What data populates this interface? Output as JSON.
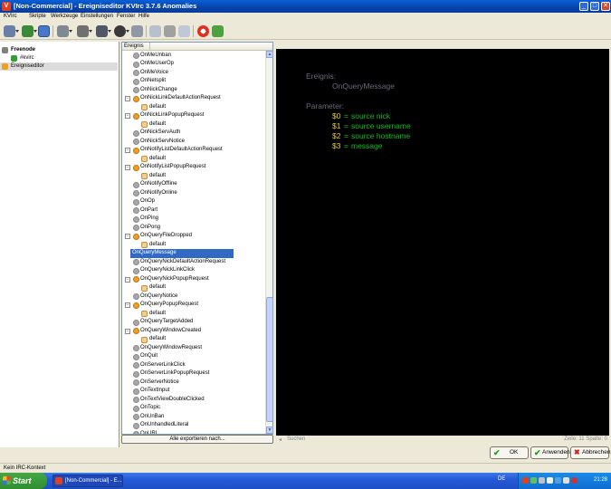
{
  "window": {
    "title": "[Non-Commercial] - Ereigniseditor KVIrc 3.7.6 Anomalies",
    "app_icon_glyph": "V",
    "controls": {
      "minimize": "_",
      "maximize": "□",
      "close": "✕"
    }
  },
  "menu": [
    "KVIrc",
    "Skripte",
    "Werkzeuge",
    "Einstellungen",
    "Fenster",
    "Hilfe"
  ],
  "sidebar": {
    "items": [
      {
        "label": "Freenode",
        "bold": true,
        "icon": "network-icon"
      },
      {
        "label": "#kvirc",
        "icon": "channel-icon"
      },
      {
        "label": "Ereigniseditor",
        "icon": "event-editor-icon",
        "selected": true
      }
    ]
  },
  "event_list": {
    "column_header": "Ereignis",
    "export_button": "Alle exportieren nach...",
    "items": [
      {
        "label": "OnMeUnban",
        "type": "event"
      },
      {
        "label": "OnMeUserOp",
        "type": "event"
      },
      {
        "label": "OnMeVoice",
        "type": "event"
      },
      {
        "label": "OnNetsplit",
        "type": "event"
      },
      {
        "label": "OnNickChange",
        "type": "event"
      },
      {
        "label": "OnNickLinkDefaultActionRequest",
        "type": "group"
      },
      {
        "label": "default",
        "type": "handler"
      },
      {
        "label": "OnNickLinkPopupRequest",
        "type": "group"
      },
      {
        "label": "default",
        "type": "handler"
      },
      {
        "label": "OnNickServAuth",
        "type": "event"
      },
      {
        "label": "OnNickServNotice",
        "type": "event"
      },
      {
        "label": "OnNotifyListDefaultActionRequest",
        "type": "group"
      },
      {
        "label": "default",
        "type": "handler"
      },
      {
        "label": "OnNotifyListPopupRequest",
        "type": "group"
      },
      {
        "label": "default",
        "type": "handler"
      },
      {
        "label": "OnNotifyOffline",
        "type": "event"
      },
      {
        "label": "OnNotifyOnline",
        "type": "event"
      },
      {
        "label": "OnOp",
        "type": "event"
      },
      {
        "label": "OnPart",
        "type": "event"
      },
      {
        "label": "OnPing",
        "type": "event"
      },
      {
        "label": "OnPong",
        "type": "event"
      },
      {
        "label": "OnQueryFileDropped",
        "type": "group"
      },
      {
        "label": "default",
        "type": "handler"
      },
      {
        "label": "OnQueryMessage",
        "type": "event",
        "selected": true
      },
      {
        "label": "OnQueryNickDefaultActionRequest",
        "type": "event"
      },
      {
        "label": "OnQueryNickLinkClick",
        "type": "event"
      },
      {
        "label": "OnQueryNickPopupRequest",
        "type": "group"
      },
      {
        "label": "default",
        "type": "handler"
      },
      {
        "label": "OnQueryNotice",
        "type": "event"
      },
      {
        "label": "OnQueryPopupRequest",
        "type": "group"
      },
      {
        "label": "default",
        "type": "handler"
      },
      {
        "label": "OnQueryTargetAdded",
        "type": "event"
      },
      {
        "label": "OnQueryWindowCreated",
        "type": "group"
      },
      {
        "label": "default",
        "type": "handler"
      },
      {
        "label": "OnQueryWindowRequest",
        "type": "event"
      },
      {
        "label": "OnQuit",
        "type": "event"
      },
      {
        "label": "OnServerLinkClick",
        "type": "event"
      },
      {
        "label": "OnServerLinkPopupRequest",
        "type": "event"
      },
      {
        "label": "OnServerNotice",
        "type": "event"
      },
      {
        "label": "OnTextInput",
        "type": "event"
      },
      {
        "label": "OnTextViewDoubleClicked",
        "type": "event"
      },
      {
        "label": "OnTopic",
        "type": "event"
      },
      {
        "label": "OnUnBan",
        "type": "event"
      },
      {
        "label": "OnUnhandledLiteral",
        "type": "event"
      },
      {
        "label": "OnURL",
        "type": "event"
      }
    ]
  },
  "editor": {
    "event_heading": "Ereignis:",
    "event_name": "OnQueryMessage",
    "params_heading": "Parameter:",
    "params": [
      {
        "var": "$0",
        "desc": "source nick"
      },
      {
        "var": "$1",
        "desc": "source username"
      },
      {
        "var": "$2",
        "desc": "source hostname"
      },
      {
        "var": "$3",
        "desc": "message"
      }
    ],
    "search_label": "Suchen",
    "position": "Zeile: 11 Spalte: 0"
  },
  "buttons": {
    "ok": "OK",
    "apply": "Anwenden",
    "cancel": "Abbrechen"
  },
  "status": "Kein IRC-Kontext",
  "taskbar": {
    "start": "Start",
    "item": "[Non-Commercial] - E...",
    "language": "DE",
    "clock": "21:28"
  }
}
